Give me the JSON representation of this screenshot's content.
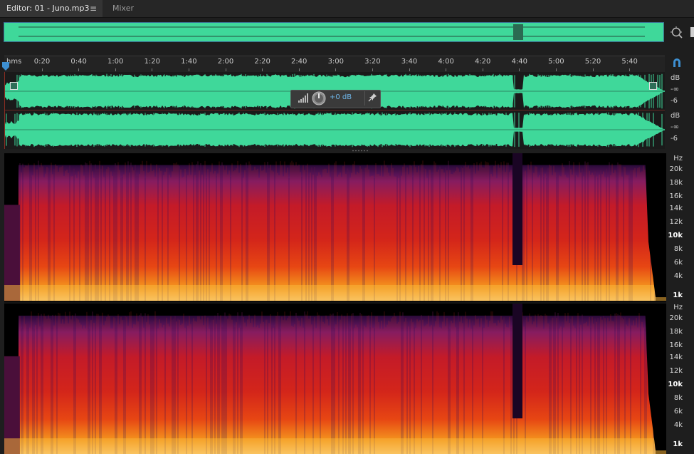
{
  "tabs": {
    "editor_label": "Editor: 01 - Juno.mp3",
    "editor_menu": "≡",
    "mixer_label": "Mixer"
  },
  "ruler": {
    "unit_label": "hms",
    "ticks": [
      "0:20",
      "0:40",
      "1:00",
      "1:20",
      "1:40",
      "2:00",
      "2:20",
      "2:40",
      "3:00",
      "3:20",
      "3:40",
      "4:00",
      "4:20",
      "4:40",
      "5:00",
      "5:20",
      "5:40"
    ]
  },
  "amplitude": {
    "unit": "dB",
    "neg_inf": "-∞",
    "minus6": "-6"
  },
  "hud": {
    "gain_value": "+0 dB"
  },
  "spectral": {
    "unit": "Hz",
    "freqs": [
      "20k",
      "18k",
      "16k",
      "14k",
      "12k",
      "10k",
      "8k",
      "6k",
      "4k",
      "1k"
    ]
  },
  "colors": {
    "waveform": "#3fd89a",
    "selection": "#3a6d92",
    "accent": "#3d8fd1"
  },
  "icons": {
    "zoom": "zoom-icon",
    "snap": "snap-magnet-icon",
    "playhead": "playhead-icon",
    "pin": "pin-icon",
    "knob": "gain-knob-icon",
    "level": "level-meter-icon"
  }
}
